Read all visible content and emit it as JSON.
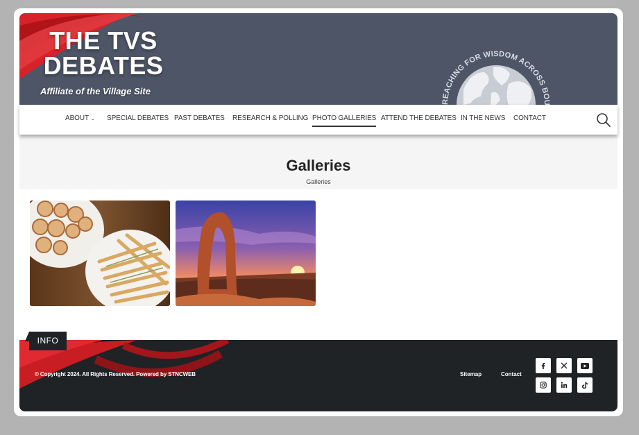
{
  "site": {
    "title_line1": "THE TVS",
    "title_line2": "DEBATES",
    "tagline": "Affiliate of the Village Site",
    "logo_text": "REACHING FOR WISDOM ACROSS BOUNDARIES"
  },
  "nav": {
    "items": [
      {
        "label": "ABOUT",
        "has_dropdown": true
      },
      {
        "label": "SPECIAL DEBATES"
      },
      {
        "label": "PAST DEBATES"
      },
      {
        "label": "RESEARCH & POLLING"
      },
      {
        "label": "PHOTO GALLERIES",
        "active": true
      },
      {
        "label": "ATTEND THE DEBATES"
      },
      {
        "label": "IN THE NEWS"
      },
      {
        "label": "CONTACT"
      }
    ],
    "search_icon": "search-icon"
  },
  "page": {
    "title": "Galleries",
    "breadcrumb": "Galleries"
  },
  "gallery": [
    {
      "name": "pastry-platters-photo"
    },
    {
      "name": "delicate-arch-sunset-photo"
    }
  ],
  "footer": {
    "tab_label": "INFO",
    "copyright": "© Copyright 2024. All Rights Reserved. Powered by STNCWEB",
    "links": [
      "Sitemap",
      "Contact"
    ],
    "social": [
      "facebook",
      "x",
      "youtube",
      "instagram",
      "linkedin",
      "tiktok"
    ]
  },
  "colors": {
    "header_bg": "#4d5567",
    "accent_red": "#c81e23",
    "footer_bg": "#1f2326",
    "page_bg": "#b3b3b3"
  }
}
